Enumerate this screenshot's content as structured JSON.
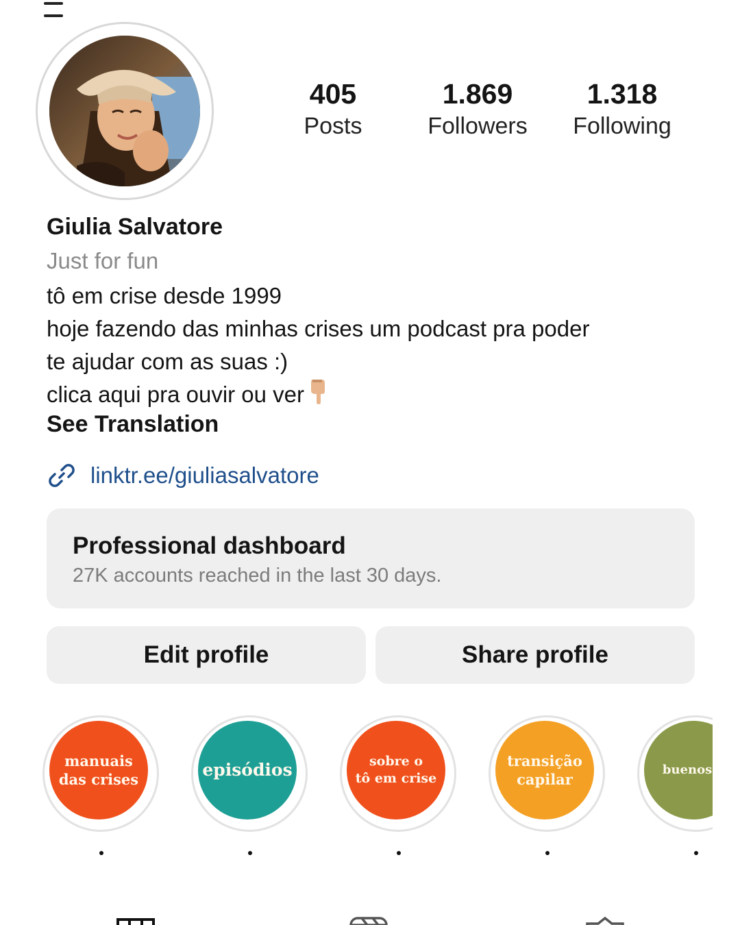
{
  "profile": {
    "name": "Giulia Salvatore",
    "category": "Just for fun",
    "bio_lines": [
      "tô em crise desde 1999",
      "hoje fazendo das minhas crises um podcast pra poder",
      "te ajudar com as suas :)",
      "clica aqui pra ouvir ou ver"
    ],
    "bio_emoji_icon": "hand-pointing-down-icon",
    "see_translation": "See Translation",
    "link": "linktr.ee/giuliasalvatore"
  },
  "stats": [
    {
      "value": "405",
      "label": "Posts"
    },
    {
      "value": "1.869",
      "label": "Followers"
    },
    {
      "value": "1.318",
      "label": "Following"
    }
  ],
  "dashboard": {
    "title": "Professional dashboard",
    "subtitle": "27K accounts reached in the last 30 days."
  },
  "buttons": {
    "edit": "Edit profile",
    "share": "Share profile"
  },
  "highlights": [
    {
      "line1": "manuais",
      "line2": "das crises",
      "color": "#f0501c"
    },
    {
      "line1": "episódios",
      "line2": "",
      "color": "#1e9f95"
    },
    {
      "line1": "sobre o",
      "line2": "tô em crise",
      "color": "#f0501c"
    },
    {
      "line1": "transição",
      "line2": "capilar",
      "color": "#f4a024"
    },
    {
      "line1": "buenos a",
      "line2": "",
      "color": "#8a9a4a"
    }
  ],
  "tabs": [
    {
      "icon": "grid-icon"
    },
    {
      "icon": "reels-icon"
    },
    {
      "icon": "tagged-icon"
    }
  ]
}
